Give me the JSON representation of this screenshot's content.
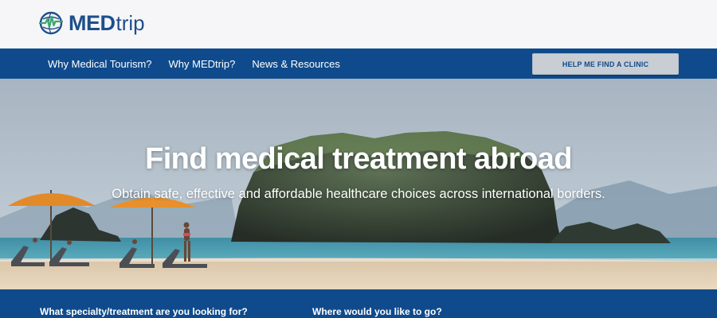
{
  "brand": {
    "name_bold": "MED",
    "name_light": "trip",
    "logo_icon": "globe-heartbeat-icon",
    "color": "#1d4f8b"
  },
  "nav": {
    "items": [
      {
        "label": "Why Medical Tourism?"
      },
      {
        "label": "Why MEDtrip?"
      },
      {
        "label": "News & Resources"
      }
    ],
    "cta_label": "HELP ME FIND A CLINIC",
    "bg_color": "#0f4b8c"
  },
  "hero": {
    "title": "Find medical treatment abroad",
    "subtitle": "Obtain safe, effective and affordable healthcare choices across international borders."
  },
  "search": {
    "specialty_label": "What specialty/treatment are you looking for?",
    "destination_label": "Where would you like to go?"
  }
}
